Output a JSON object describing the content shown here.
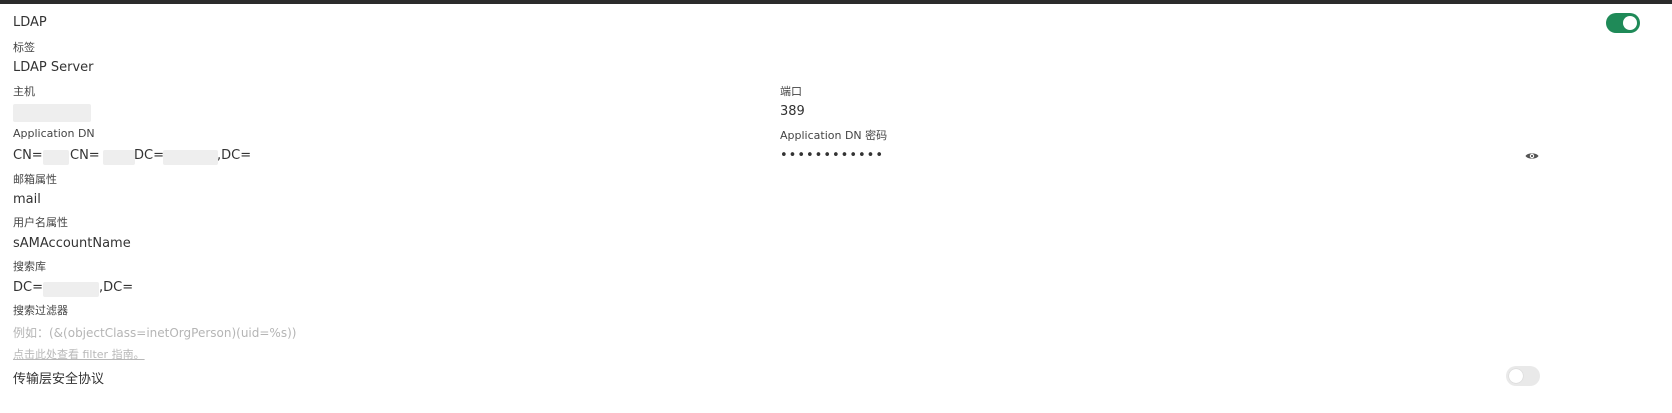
{
  "ldap": {
    "title": "LDAP",
    "enabled": true,
    "accent_color": "#1f8a58"
  },
  "form": {
    "label_field": {
      "label": "标签",
      "value": "LDAP Server"
    },
    "host_field": {
      "label": "主机",
      "value": ""
    },
    "port_field": {
      "label": "端口",
      "value": "389"
    },
    "app_dn_field": {
      "label": "Application DN",
      "value_parts": [
        "CN=",
        "CN=",
        "DC=",
        ",DC="
      ]
    },
    "app_dn_password_field": {
      "label": "Application DN 密码",
      "value": "••••••••••••",
      "toggle_icon": "eye-icon"
    },
    "email_attr_field": {
      "label": "邮箱属性",
      "value": "mail"
    },
    "username_attr_field": {
      "label": "用户名属性",
      "value": "sAMAccountName"
    },
    "search_base_field": {
      "label": "搜索库",
      "value_parts": [
        "DC=",
        ",DC="
      ]
    },
    "search_filter_field": {
      "label": "搜索过滤器",
      "placeholder": "例如：(&(objectClass=inetOrgPerson)(uid=%s))",
      "help_link": "点击此处查看 filter 指南。"
    },
    "tls_field": {
      "label": "传输层安全协议",
      "enabled": false
    }
  }
}
